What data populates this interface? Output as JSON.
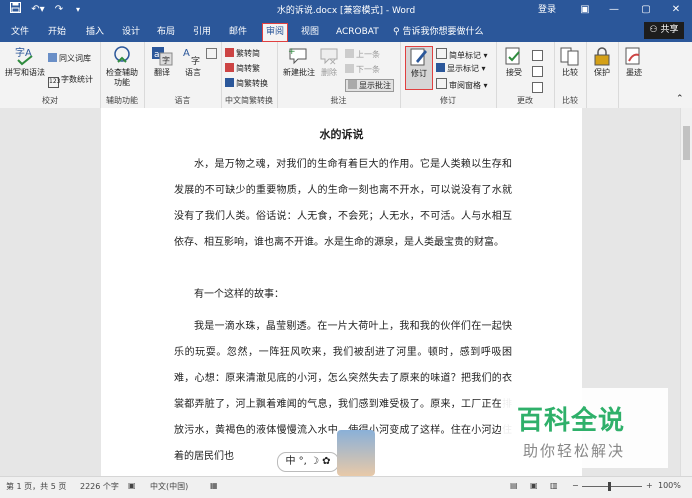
{
  "titlebar": {
    "title": "水的诉说.docx [兼容模式] - Word",
    "login": "登录",
    "icons": [
      "save-icon",
      "undo-icon",
      "redo-icon",
      "customize-icon"
    ],
    "win_minimize": "—",
    "win_maximize": "▢",
    "win_close": "✕",
    "ribbon_display": "▣"
  },
  "tabs": {
    "items": [
      "文件",
      "开始",
      "插入",
      "设计",
      "布局",
      "引用",
      "邮件",
      "审阅",
      "视图",
      "ACROBAT"
    ],
    "active": "审阅",
    "tellme": "告诉我你想要做什么",
    "share": "共享"
  },
  "ribbon": {
    "proofing": {
      "label": "校对",
      "spelling": "拼写和语法",
      "thesaurus": "同义词库",
      "wordcount": "字数统计"
    },
    "accessibility": {
      "label": "辅助功能",
      "check": "检查辅助功能"
    },
    "language": {
      "label": "语言",
      "translate": "翻译",
      "language": "语言"
    },
    "chinese": {
      "label": "中文简繁转换",
      "to_simplified": "繁转简",
      "to_traditional": "简转繁",
      "convert": "简繁转换"
    },
    "comments": {
      "label": "批注",
      "new": "新建批注",
      "delete": "删除",
      "previous": "上一条",
      "next": "下一条",
      "show": "显示批注"
    },
    "tracking": {
      "label": "修订",
      "track": "修订",
      "markup": "简单标记",
      "show_markup": "显示标记",
      "pane": "审阅窗格"
    },
    "changes": {
      "label": "更改",
      "accept": "接受"
    },
    "compare": {
      "label": "比较",
      "compare": "比较"
    },
    "protect": {
      "protect": "保护"
    },
    "ink": {
      "ink": "墨迹"
    }
  },
  "document": {
    "title": "水的诉说",
    "paragraphs": [
      "水，是万物之魂，对我们的生命有着巨大的作用。它是人类赖以生存和发展的不可缺少的重要物质，人的生命一刻也离不开水，可以说没有了水就没有了我们人类。俗话说：人无食，不会死；人无水，不可活。人与水相互依存、相互影响，谁也离不开谁。水是生命的源泉，是人类最宝贵的财富。",
      "有一个这样的故事：",
      "我是一滴水珠，晶莹剔透。在一片大荷叶上，我和我的伙伴们在一起快乐的玩耍。忽然，一阵狂风吹来，我们被刮进了河里。顿时，感到呼吸困难，心想：原来清澈见底的小河，怎么突然失去了原来的味道？把我们的衣裳都弄脏了，河上飘着难闻的气息，我们感到难受极了。原来，工厂正在排放污水，黄褐色的液体慢慢流入水中，使得小河变成了这样。住在小河边住着的居民们也"
    ]
  },
  "ime": {
    "text": "中 °, ☽ ✿"
  },
  "watermark": {
    "line1": "百科全说",
    "line2": "助你轻松解决"
  },
  "statusbar": {
    "page": "第 1 页，共 5 页",
    "words": "2226 个字",
    "lang": "中文(中国)",
    "zoom": "100%"
  }
}
